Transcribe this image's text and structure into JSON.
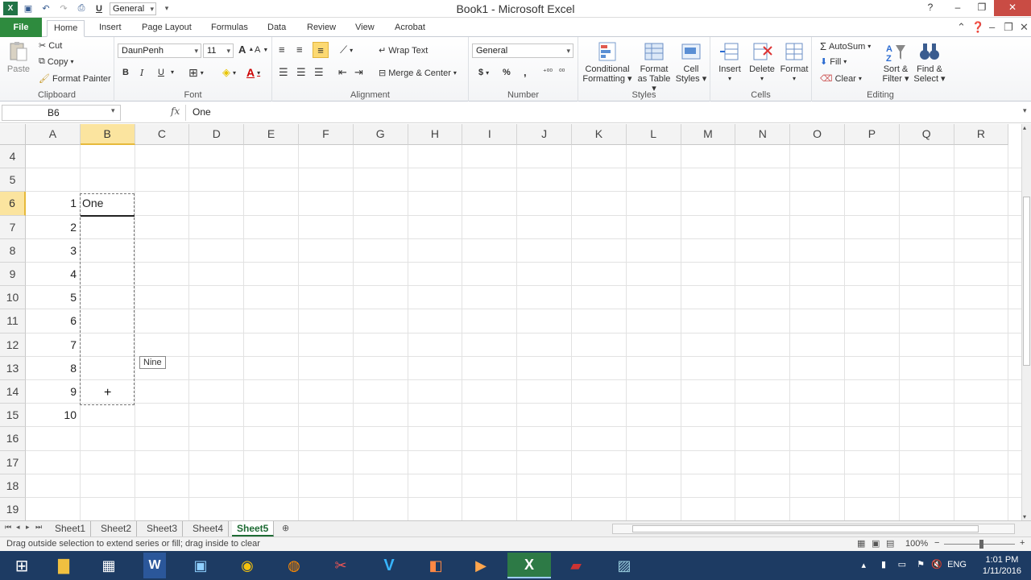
{
  "window": {
    "title": "Book1 - Microsoft Excel"
  },
  "qat": {
    "number_format": "General"
  },
  "tabs": [
    "File",
    "Home",
    "Insert",
    "Page Layout",
    "Formulas",
    "Data",
    "Review",
    "View",
    "Acrobat"
  ],
  "ribbon": {
    "clipboard": {
      "label": "Clipboard",
      "paste": "Paste",
      "cut": "Cut",
      "copy": "Copy",
      "format_painter": "Format Painter"
    },
    "font": {
      "label": "Font",
      "family": "DaunPenh",
      "size": "11",
      "bold": "B",
      "italic": "I",
      "underline": "U"
    },
    "alignment": {
      "label": "Alignment",
      "wrap_text": "Wrap Text",
      "merge_center": "Merge & Center"
    },
    "number": {
      "label": "Number",
      "format": "General",
      "currency": "$",
      "percent": "%",
      "comma": ","
    },
    "styles": {
      "label": "Styles",
      "conditional_1": "Conditional",
      "conditional_2": "Formatting",
      "format_table_1": "Format",
      "format_table_2": "as Table",
      "cell_styles_1": "Cell",
      "cell_styles_2": "Styles"
    },
    "cells": {
      "label": "Cells",
      "insert": "Insert",
      "delete": "Delete",
      "format": "Format"
    },
    "editing": {
      "label": "Editing",
      "autosum": "AutoSum",
      "fill": "Fill",
      "clear": "Clear",
      "sort_1": "Sort &",
      "sort_2": "Filter",
      "find_1": "Find &",
      "find_2": "Select"
    }
  },
  "formula_bar": {
    "name_box": "B6",
    "fx": "fx",
    "value": "One"
  },
  "grid": {
    "columns": [
      "A",
      "B",
      "C",
      "D",
      "E",
      "F",
      "G",
      "H",
      "I",
      "J",
      "K",
      "L",
      "M",
      "N",
      "O",
      "P",
      "Q",
      "R"
    ],
    "rows": [
      "4",
      "5",
      "6",
      "7",
      "8",
      "9",
      "10",
      "11",
      "12",
      "13",
      "14",
      "15",
      "16",
      "17",
      "18",
      "19"
    ],
    "col_a_values": [
      "",
      "",
      "1",
      "2",
      "3",
      "4",
      "5",
      "6",
      "7",
      "8",
      "9",
      "10",
      "",
      "",
      "",
      ""
    ],
    "b6": "One",
    "tooltip": "Nine"
  },
  "sheets": [
    "Sheet1",
    "Sheet2",
    "Sheet3",
    "Sheet4",
    "Sheet5"
  ],
  "active_sheet": "Sheet5",
  "status": {
    "message": "Drag outside selection to extend series or fill; drag inside to clear",
    "zoom": "100%"
  },
  "taskbar": {
    "lang": "ENG",
    "time": "1:01 PM",
    "date": "1/11/2016"
  }
}
